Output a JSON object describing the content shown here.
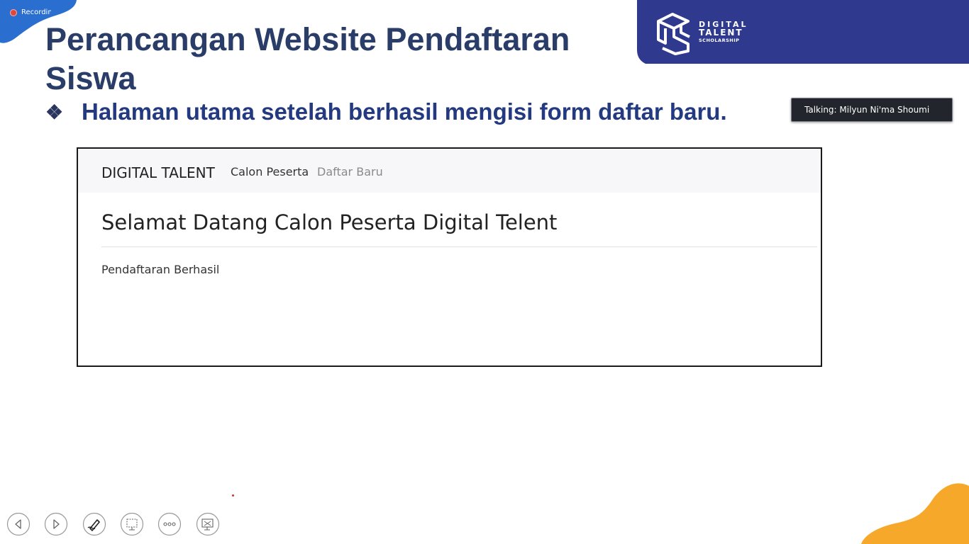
{
  "recording": {
    "label": "Recording"
  },
  "slide": {
    "title": "Perancangan Website  Pendaftaran Siswa",
    "bullet_text": "Halaman utama setelah berhasil mengisi form daftar baru.",
    "bullet_icon": "four-diamond-bullet-icon"
  },
  "logo": {
    "line1": "DIGITAL",
    "line2": "TALENT",
    "line3": "SCHOLARSHIP"
  },
  "talking": {
    "text": "Talking: Milyun Ni'ma Shoumi"
  },
  "webpage": {
    "navbar": {
      "brand": "DIGITAL TALENT",
      "links": [
        {
          "label": "Calon Peserta"
        },
        {
          "label": "Daftar Baru"
        }
      ]
    },
    "heading": "Selamat Datang Calon Peserta Digital Telent",
    "message": "Pendaftaran Berhasil"
  },
  "controls": [
    "previous-icon",
    "next-icon",
    "pen-icon",
    "zoom-icon",
    "more-icon",
    "presenter-view-icon"
  ],
  "colors": {
    "banner": "#2f3a8e",
    "title": "#2a3c68",
    "subtitle": "#233a80",
    "accent_blob_top": "#2a6fd0",
    "accent_blob_bottom": "#f6a82a"
  }
}
